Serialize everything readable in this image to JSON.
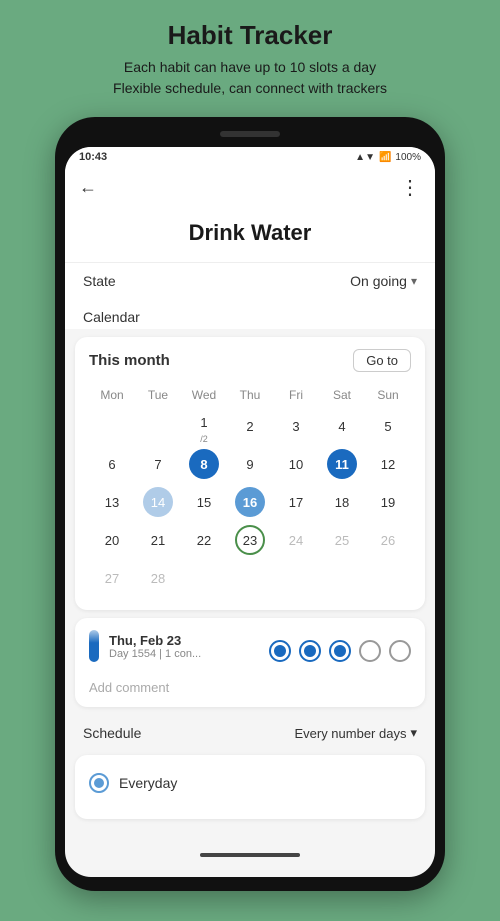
{
  "app": {
    "title": "Habit Tracker",
    "subtitle_line1": "Each habit can have up to 10 slots a day",
    "subtitle_line2": "Flexible schedule, can connect with trackers"
  },
  "status_bar": {
    "time": "10:43",
    "battery": "100%",
    "signal": "▲▼"
  },
  "screen": {
    "habit_name": "Drink Water",
    "back_icon": "←",
    "menu_icon": "⋮",
    "state_label": "State",
    "state_value": "On going",
    "state_arrow": "▾",
    "calendar_label": "Calendar",
    "calendar_month": "This month",
    "goto_btn": "Go to",
    "day_headers": [
      "Mon",
      "Tue",
      "Wed",
      "Thu",
      "Fri",
      "Sat",
      "Sun"
    ],
    "weeks": [
      [
        {
          "num": "",
          "style": "empty"
        },
        {
          "num": "",
          "style": "empty"
        },
        {
          "num": "1",
          "style": "normal",
          "sub": "/2"
        },
        {
          "num": "2",
          "style": "normal"
        },
        {
          "num": "3",
          "style": "normal"
        },
        {
          "num": "4",
          "style": "normal"
        },
        {
          "num": "5",
          "style": "normal"
        }
      ],
      [
        {
          "num": "6",
          "style": "normal"
        },
        {
          "num": "7",
          "style": "normal"
        },
        {
          "num": "8",
          "style": "filled-dark"
        },
        {
          "num": "9",
          "style": "normal"
        },
        {
          "num": "10",
          "style": "normal"
        },
        {
          "num": "11",
          "style": "filled-dark"
        },
        {
          "num": "12",
          "style": "normal"
        }
      ],
      [
        {
          "num": "13",
          "style": "normal"
        },
        {
          "num": "14",
          "style": "light-blue"
        },
        {
          "num": "15",
          "style": "normal"
        },
        {
          "num": "16",
          "style": "filled"
        },
        {
          "num": "17",
          "style": "normal"
        },
        {
          "num": "18",
          "style": "normal"
        },
        {
          "num": "19",
          "style": "normal"
        }
      ],
      [
        {
          "num": "20",
          "style": "normal"
        },
        {
          "num": "21",
          "style": "normal"
        },
        {
          "num": "22",
          "style": "normal"
        },
        {
          "num": "23",
          "style": "today"
        },
        {
          "num": "24",
          "style": "gray"
        },
        {
          "num": "25",
          "style": "gray"
        },
        {
          "num": "26",
          "style": "gray"
        }
      ],
      [
        {
          "num": "27",
          "style": "gray"
        },
        {
          "num": "28",
          "style": "gray"
        },
        {
          "num": "",
          "style": "empty"
        },
        {
          "num": "",
          "style": "empty"
        },
        {
          "num": "",
          "style": "empty"
        },
        {
          "num": "",
          "style": "empty"
        },
        {
          "num": "",
          "style": "empty"
        }
      ]
    ],
    "day_detail": {
      "date": "Thu, Feb 23",
      "sub": "Day 1554 | 1 con...",
      "circles": [
        "filled",
        "filled",
        "filled-dark",
        "empty",
        "empty"
      ],
      "add_comment": "Add comment"
    },
    "schedule_label": "Schedule",
    "schedule_value": "Every number days",
    "schedule_arrow": "▾",
    "schedule_options": [
      {
        "label": "Everyday",
        "selected": true
      }
    ]
  }
}
